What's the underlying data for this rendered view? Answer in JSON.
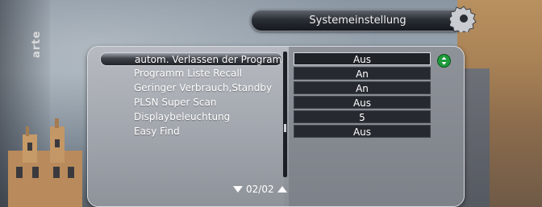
{
  "header": {
    "title": "Systemeinstellung",
    "channel_logo": "arte"
  },
  "menu": {
    "items": [
      {
        "label": "autom. Verlassen der Programm",
        "value": "Aus",
        "selected": true
      },
      {
        "label": "Programm Liste Recall",
        "value": "An"
      },
      {
        "label": "Geringer Verbrauch,Standby",
        "value": "An"
      },
      {
        "label": "PLSN Super Scan",
        "value": "Aus"
      },
      {
        "label": "Displaybeleuchtung",
        "value": "5"
      },
      {
        "label": "Easy Find",
        "value": "Aus"
      }
    ]
  },
  "pagination": {
    "page": "02/02"
  },
  "icons": {
    "nav": "left-right-arrows-icon",
    "settings": "gear-icon",
    "page_down": "triangle-down-icon",
    "page_up": "triangle-up-icon"
  },
  "colors": {
    "nav_icon": "#1f9a3c",
    "value_box": "#262a30"
  }
}
